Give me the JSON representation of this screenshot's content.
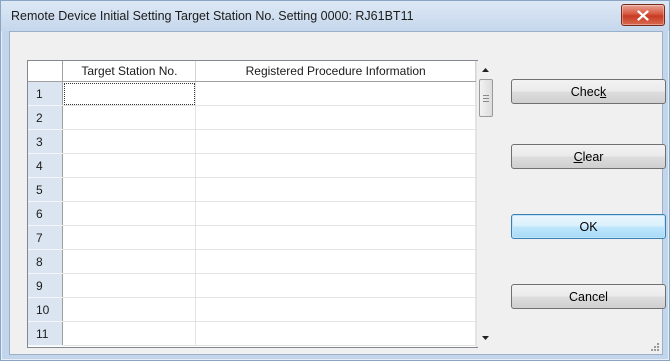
{
  "window": {
    "title": "Remote Device Initial Setting Target Station No. Setting 0000: RJ61BT11",
    "close_icon": "close-x-icon"
  },
  "grid": {
    "columns": [
      "Target Station No.",
      "Registered Procedure Information"
    ],
    "rows": [
      {
        "num": "1",
        "target": "",
        "info": ""
      },
      {
        "num": "2",
        "target": "",
        "info": ""
      },
      {
        "num": "3",
        "target": "",
        "info": ""
      },
      {
        "num": "4",
        "target": "",
        "info": ""
      },
      {
        "num": "5",
        "target": "",
        "info": ""
      },
      {
        "num": "6",
        "target": "",
        "info": ""
      },
      {
        "num": "7",
        "target": "",
        "info": ""
      },
      {
        "num": "8",
        "target": "",
        "info": ""
      },
      {
        "num": "9",
        "target": "",
        "info": ""
      },
      {
        "num": "10",
        "target": "",
        "info": ""
      },
      {
        "num": "11",
        "target": "",
        "info": ""
      }
    ]
  },
  "buttons": {
    "check": {
      "pre": "Chec",
      "accel": "k",
      "post": ""
    },
    "clear": {
      "pre": "",
      "accel": "C",
      "post": "lear"
    },
    "ok": "OK",
    "cancel": "Cancel"
  },
  "colors": {
    "row_header_bg": "#dbe5f1",
    "default_button_border": "#3c7fb1",
    "close_button": "#c73b23"
  }
}
